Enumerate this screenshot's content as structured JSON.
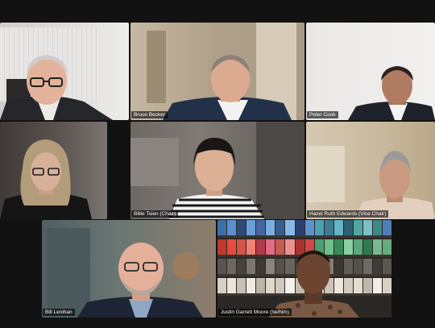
{
  "participants": [
    {
      "id": "p1",
      "name": "",
      "bg": "#d7d6d3"
    },
    {
      "id": "p2",
      "name": "Bruce Becker",
      "bg": "#b8a995"
    },
    {
      "id": "p3",
      "name": "Peter Cook",
      "bg": "#ecebe9"
    },
    {
      "id": "p4",
      "name": "",
      "bg": "#4b4643"
    },
    {
      "id": "p5",
      "name": "Billie Tsien (Chair)",
      "bg": "#6e6a67"
    },
    {
      "id": "p6",
      "name": "Hazel Ruth Edwards (Vice Chair)",
      "bg": "#cdbfa8"
    },
    {
      "id": "p7",
      "name": "Bill Lenihan",
      "bg": "#5f6e70"
    },
    {
      "id": "p8",
      "name": "Justin Garrett Moore (he/him)",
      "bg": "#2b2724"
    }
  ]
}
